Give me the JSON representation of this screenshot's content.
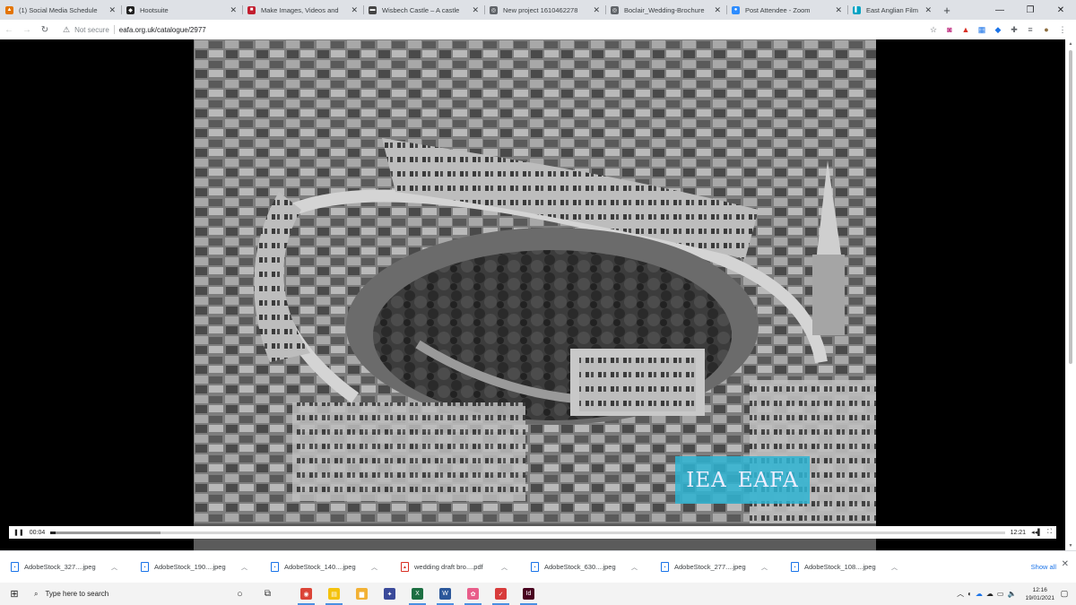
{
  "browser": {
    "tabs": [
      {
        "title": "(1) Social Media Schedule",
        "icon": "hootsuite-favicon",
        "color": "#e37400",
        "glyph": "▲"
      },
      {
        "title": "Hootsuite",
        "icon": "hootsuite-owl-favicon",
        "color": "#222222",
        "glyph": "◆"
      },
      {
        "title": "Make Images, Videos and",
        "icon": "spark-favicon",
        "color": "#c21e2f",
        "glyph": "■"
      },
      {
        "title": "Wisbech Castle – A castle",
        "icon": "castle-favicon",
        "color": "#444444",
        "glyph": "▬"
      },
      {
        "title": "New project 1610462278",
        "icon": "globe-favicon",
        "color": "#5f6368",
        "glyph": "◎"
      },
      {
        "title": "Boclair_Wedding-Brochure",
        "icon": "globe-favicon",
        "color": "#5f6368",
        "glyph": "◎"
      },
      {
        "title": "Post Attendee - Zoom",
        "icon": "zoom-favicon",
        "color": "#2d8cff",
        "glyph": "●"
      },
      {
        "title": "East Anglian Film Arch",
        "icon": "eafa-favicon",
        "color": "#00a3c4",
        "glyph": "▌"
      }
    ],
    "tab_close": "✕",
    "new_tab": "+",
    "security": "Not secure",
    "url": "eafa.org.uk/catalogue/2977"
  },
  "player": {
    "watermark_left": "IEA",
    "watermark_right": "EAFA",
    "current_time": "00:04",
    "duration": "12:21",
    "progress_fraction": 0.005,
    "buffered_fraction": 0.115
  },
  "downloads": {
    "items": [
      {
        "name": "AdobeStock_327....jpeg",
        "type": "jpeg"
      },
      {
        "name": "AdobeStock_190....jpeg",
        "type": "jpeg"
      },
      {
        "name": "AdobeStock_140....jpeg",
        "type": "jpeg"
      },
      {
        "name": "wedding draft bro....pdf",
        "type": "pdf"
      },
      {
        "name": "AdobeStock_630....jpeg",
        "type": "jpeg"
      },
      {
        "name": "AdobeStock_277....jpeg",
        "type": "jpeg"
      },
      {
        "name": "AdobeStock_108....jpeg",
        "type": "jpeg"
      }
    ],
    "show_all": "Show all"
  },
  "taskbar": {
    "search_placeholder": "Type here to search",
    "apps": [
      {
        "name": "chrome",
        "color": "#db4437",
        "glyph": "◉",
        "open": true
      },
      {
        "name": "sticky-notes",
        "color": "#f4c20d",
        "glyph": "▤",
        "open": true
      },
      {
        "name": "file-explorer",
        "color": "#f2b134",
        "glyph": "▆",
        "open": false
      },
      {
        "name": "app-blue",
        "color": "#3a4a9a",
        "glyph": "✦",
        "open": false
      },
      {
        "name": "excel",
        "color": "#1d6f42",
        "glyph": "X",
        "open": true
      },
      {
        "name": "word",
        "color": "#2b579a",
        "glyph": "W",
        "open": true
      },
      {
        "name": "paint",
        "color": "#e85d8a",
        "glyph": "✿",
        "open": true
      },
      {
        "name": "snip",
        "color": "#d83b3b",
        "glyph": "✓",
        "open": true
      },
      {
        "name": "indesign",
        "color": "#49021f",
        "glyph": "Id",
        "open": true
      }
    ],
    "time": "12:16",
    "date": "19/01/2021"
  }
}
